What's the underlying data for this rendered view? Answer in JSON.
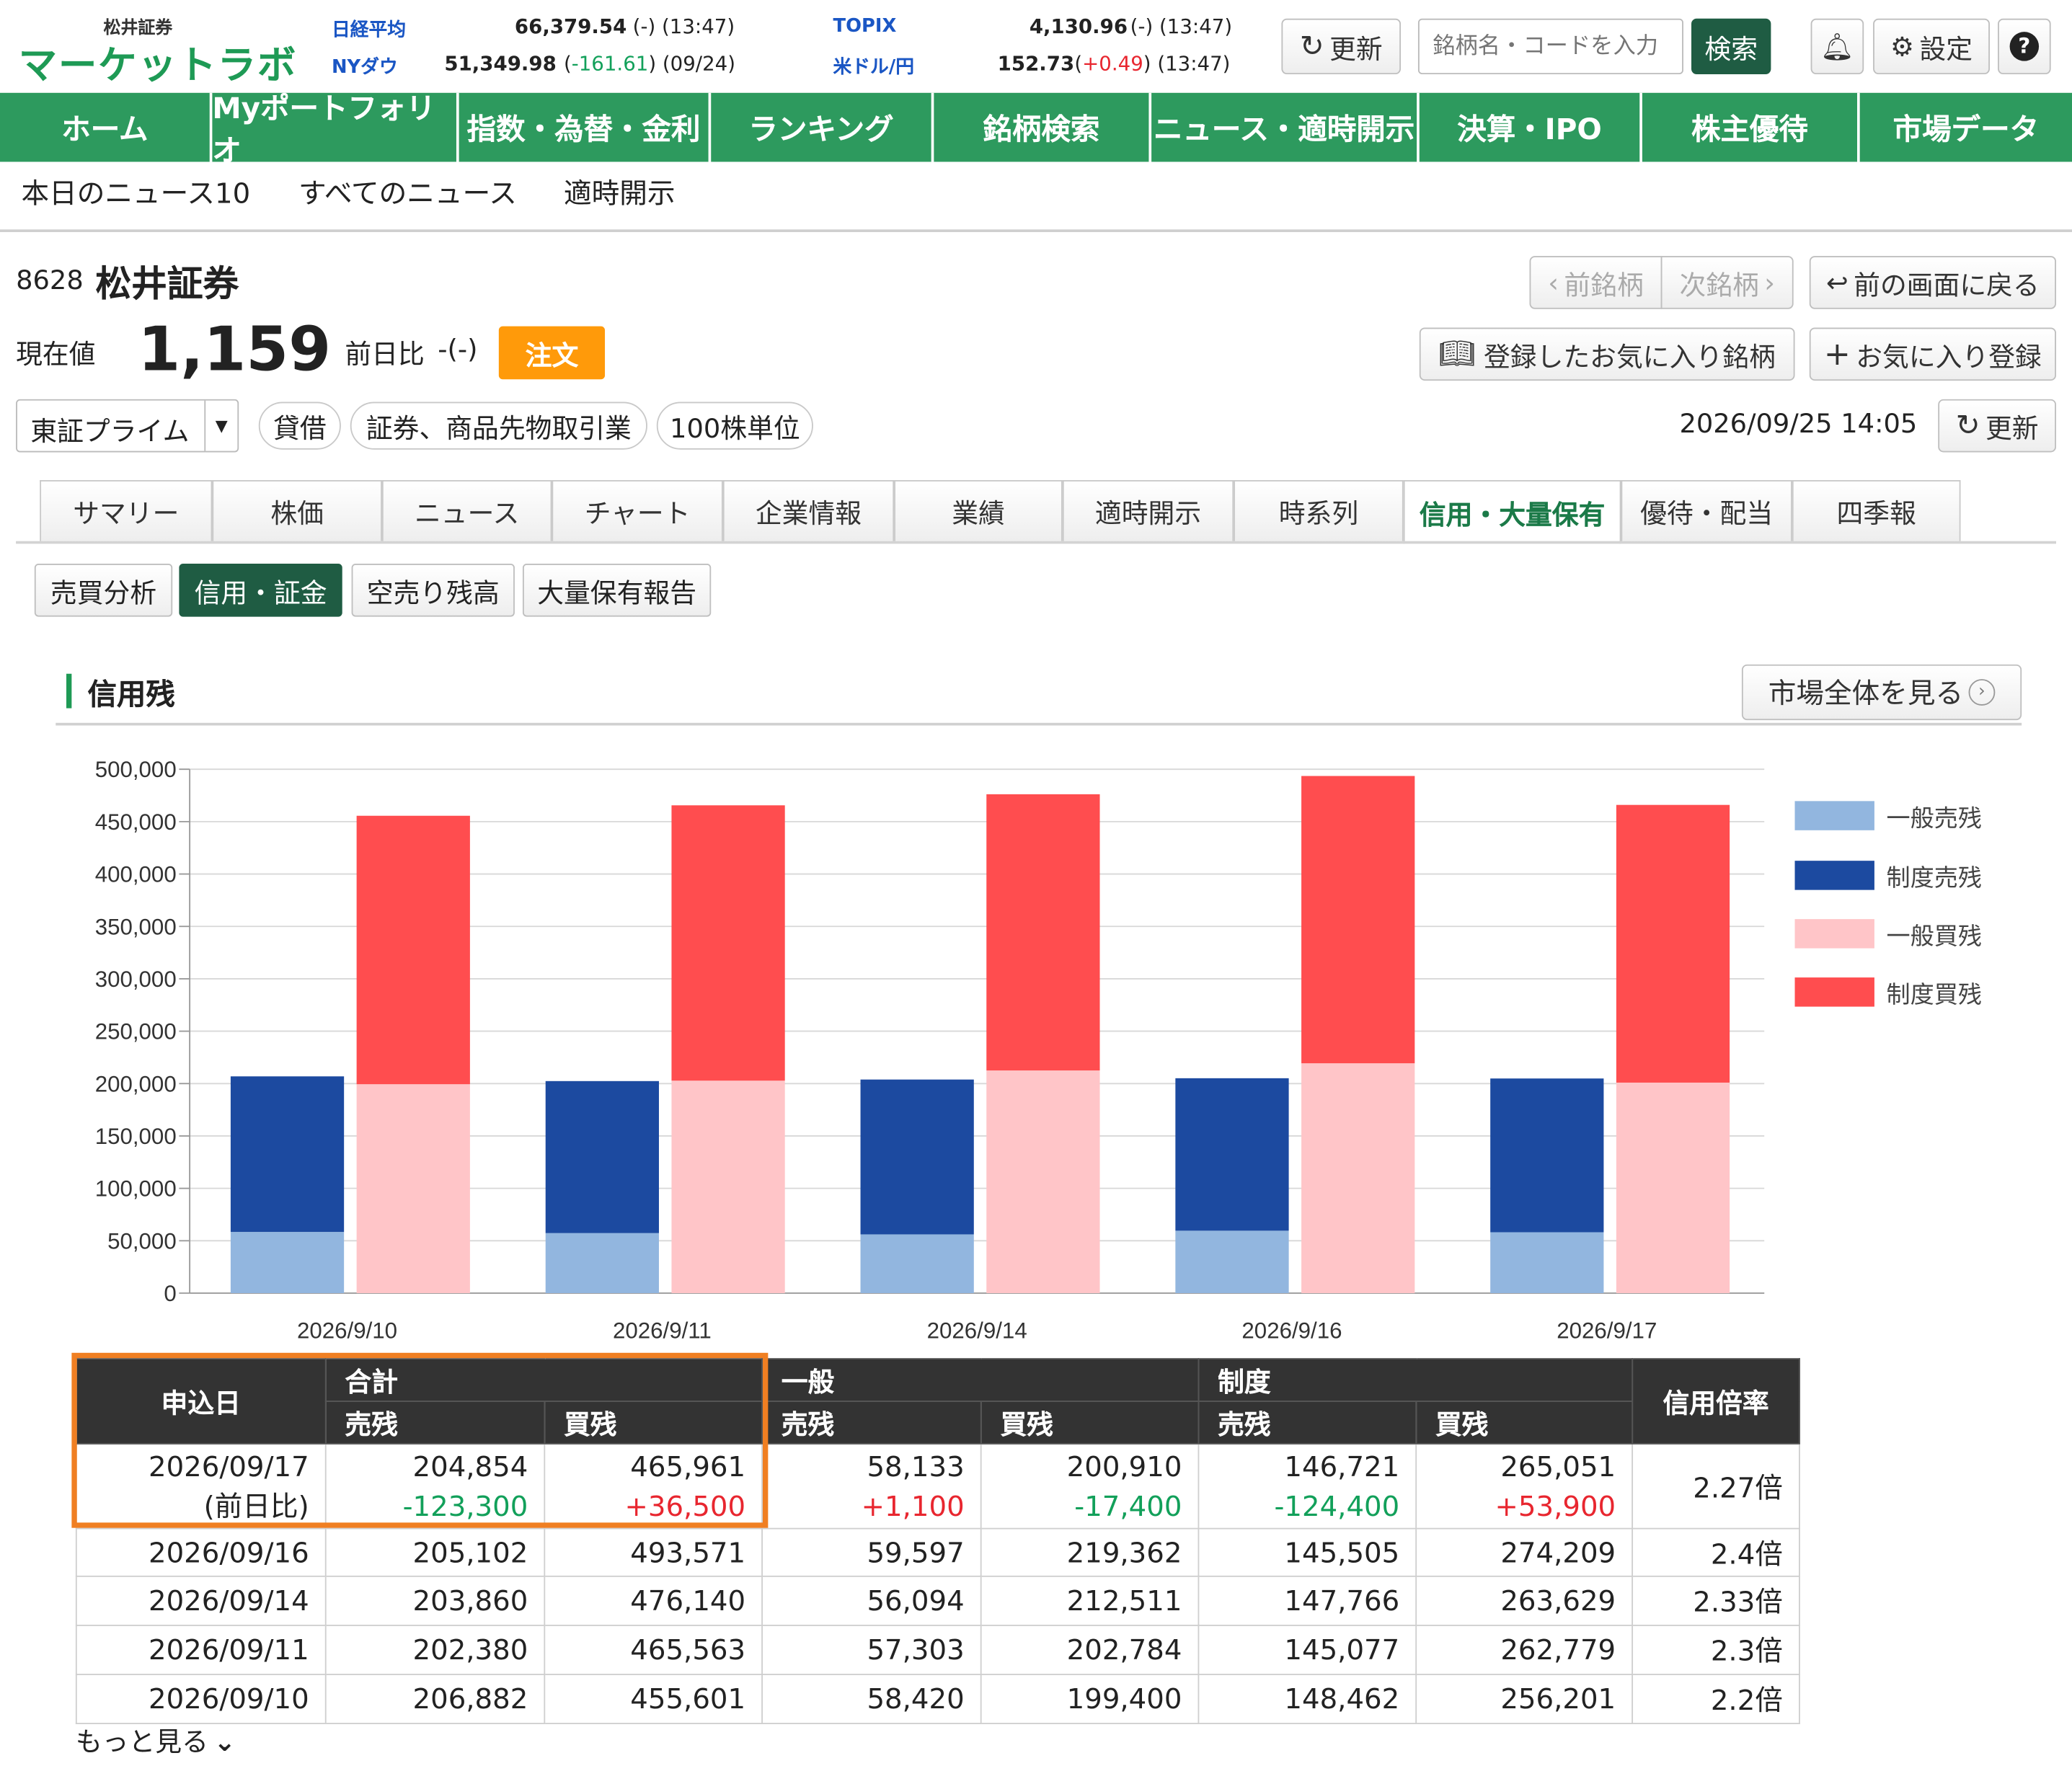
{
  "brand": {
    "small": "松井証券",
    "main": "マーケットラボ"
  },
  "tickers": [
    {
      "label": "日経平均",
      "value": "66,379.54",
      "paren_open": "(",
      "change": "-",
      "paren_close": ")",
      "time": "(13:47)",
      "dir": "none"
    },
    {
      "label": "NYダウ",
      "value": "51,349.98",
      "paren_open": "(",
      "change": "-161.61",
      "paren_close": ")",
      "time": "(09/24)",
      "dir": "neg"
    },
    {
      "label": "TOPIX",
      "value": "4,130.96",
      "paren_open": "(",
      "change": "-",
      "paren_close": ")",
      "time": "(13:47)",
      "dir": "none"
    },
    {
      "label": "米ドル/円",
      "value": "152.73",
      "paren_open": "(",
      "change": "+0.49",
      "paren_close": ")",
      "time": "(13:47)",
      "dir": "pos"
    }
  ],
  "header": {
    "refresh_label": "更新",
    "search_placeholder": "銘柄名・コードを入力",
    "search_button": "検索",
    "settings_label": "設定",
    "help": "?"
  },
  "nav": [
    "ホーム",
    "Myポートフォリオ",
    "指数・為替・金利",
    "ランキング",
    "銘柄検索",
    "ニュース・適時開示",
    "決算・IPO",
    "株主優待",
    "市場データ"
  ],
  "subnav": [
    "本日のニュース10",
    "すべてのニュース",
    "適時開示"
  ],
  "stock": {
    "code": "8628",
    "name": "松井証券",
    "price_label": "現在値",
    "price": "1,159",
    "change_label": "前日比",
    "change": "-(-)",
    "order_button": "注文",
    "market": "東証プライム",
    "tags": [
      "貸借",
      "証券、商品先物取引業",
      "100株単位"
    ],
    "datetime": "2026/09/25 14:05",
    "refresh_label": "更新"
  },
  "stock_nav": {
    "prev": "前銘柄",
    "next": "次銘柄",
    "back": "前の画面に戻る",
    "favorites": "登録したお気に入り銘柄",
    "add_favorite": "お気に入り登録"
  },
  "tabs": [
    "サマリー",
    "株価",
    "ニュース",
    "チャート",
    "企業情報",
    "業績",
    "適時開示",
    "時系列",
    "信用・大量保有",
    "優待・配当",
    "四季報"
  ],
  "active_tab": 8,
  "subtabs": [
    "売買分析",
    "信用・証金",
    "空売り残高",
    "大量保有報告"
  ],
  "active_subtab": 1,
  "section": {
    "title": "信用残",
    "market_button": "市場全体を見る"
  },
  "colors": {
    "general_sell": "#92b6df",
    "system_sell": "#1c4aa0",
    "general_buy": "#ffc5c8",
    "system_buy": "#ff4d4f",
    "nav_green": "#2d9a5e",
    "order_orange": "#ff9a0a",
    "highlight": "#f07f22"
  },
  "chart_data": {
    "type": "bar",
    "stacked": true,
    "categories": [
      "2026/9/10",
      "2026/9/11",
      "2026/9/14",
      "2026/9/16",
      "2026/9/17"
    ],
    "series": [
      {
        "name": "一般売残",
        "group": "sell",
        "values": [
          58420,
          57303,
          56094,
          59597,
          58133
        ]
      },
      {
        "name": "制度売残",
        "group": "sell",
        "values": [
          148462,
          145077,
          147766,
          145505,
          146721
        ]
      },
      {
        "name": "一般買残",
        "group": "buy",
        "values": [
          199400,
          202784,
          212511,
          219362,
          200910
        ]
      },
      {
        "name": "制度買残",
        "group": "buy",
        "values": [
          256201,
          262779,
          263629,
          274209,
          265051
        ]
      }
    ],
    "y_ticks": [
      "500,000",
      "450,000",
      "400,000",
      "350,000",
      "300,000",
      "250,000",
      "200,000",
      "150,000",
      "100,000",
      "50,000",
      "0"
    ],
    "ylim": [
      0,
      500000
    ],
    "grid": true,
    "legend": "right"
  },
  "table": {
    "headers": {
      "date": "申込日",
      "total": "合計",
      "general": "一般",
      "system": "制度",
      "ratio": "信用倍率",
      "sell": "売残",
      "buy": "買残"
    },
    "first_row": {
      "date": "2026/09/17",
      "sub": "(前日比)",
      "cells": [
        [
          "204,854",
          "-123,300",
          "neg"
        ],
        [
          "465,961",
          "+36,500",
          "pos"
        ],
        [
          "58,133",
          "+1,100",
          "pos"
        ],
        [
          "200,910",
          "-17,400",
          "neg"
        ],
        [
          "146,721",
          "-124,400",
          "neg"
        ],
        [
          "265,051",
          "+53,900",
          "pos"
        ]
      ],
      "ratio": "2.27倍"
    },
    "rows": [
      [
        "2026/09/16",
        "205,102",
        "493,571",
        "59,597",
        "219,362",
        "145,505",
        "274,209",
        "2.4倍"
      ],
      [
        "2026/09/14",
        "203,860",
        "476,140",
        "56,094",
        "212,511",
        "147,766",
        "263,629",
        "2.33倍"
      ],
      [
        "2026/09/11",
        "202,380",
        "465,563",
        "57,303",
        "202,784",
        "145,077",
        "262,779",
        "2.3倍"
      ],
      [
        "2026/09/10",
        "206,882",
        "455,601",
        "58,420",
        "199,400",
        "148,462",
        "256,201",
        "2.2倍"
      ]
    ],
    "more": "もっと見る"
  }
}
